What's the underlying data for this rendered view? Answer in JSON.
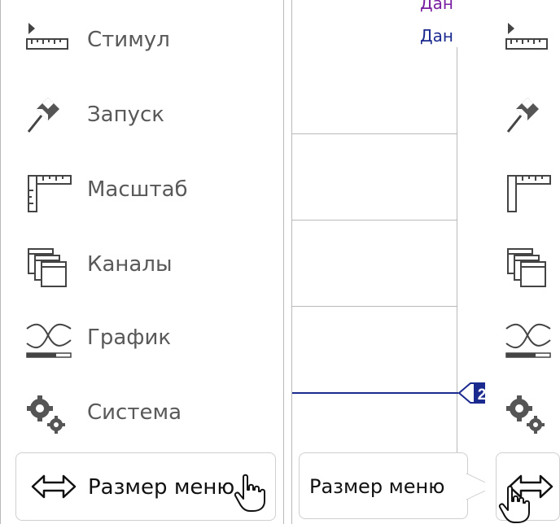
{
  "menu": {
    "items": [
      {
        "label": "Стимул",
        "icon": "stimulus-ruler-icon"
      },
      {
        "label": "Запуск",
        "icon": "trigger-flag-icon"
      },
      {
        "label": "Масштаб",
        "icon": "scale-ruler-icon"
      },
      {
        "label": "Каналы",
        "icon": "channels-windows-icon"
      },
      {
        "label": "График",
        "icon": "trace-graph-icon"
      },
      {
        "label": "Система",
        "icon": "system-gears-icon"
      }
    ],
    "size_button_label": "Размер меню"
  },
  "graph": {
    "legend_line1": "Дан",
    "legend_line2": "Дан",
    "marker_number": "2",
    "trace_color": "#1b2a8f",
    "legend_color1": "#7a1fa2",
    "legend_color2": "#1b2a8f"
  },
  "tooltip": {
    "text": "Размер меню"
  }
}
